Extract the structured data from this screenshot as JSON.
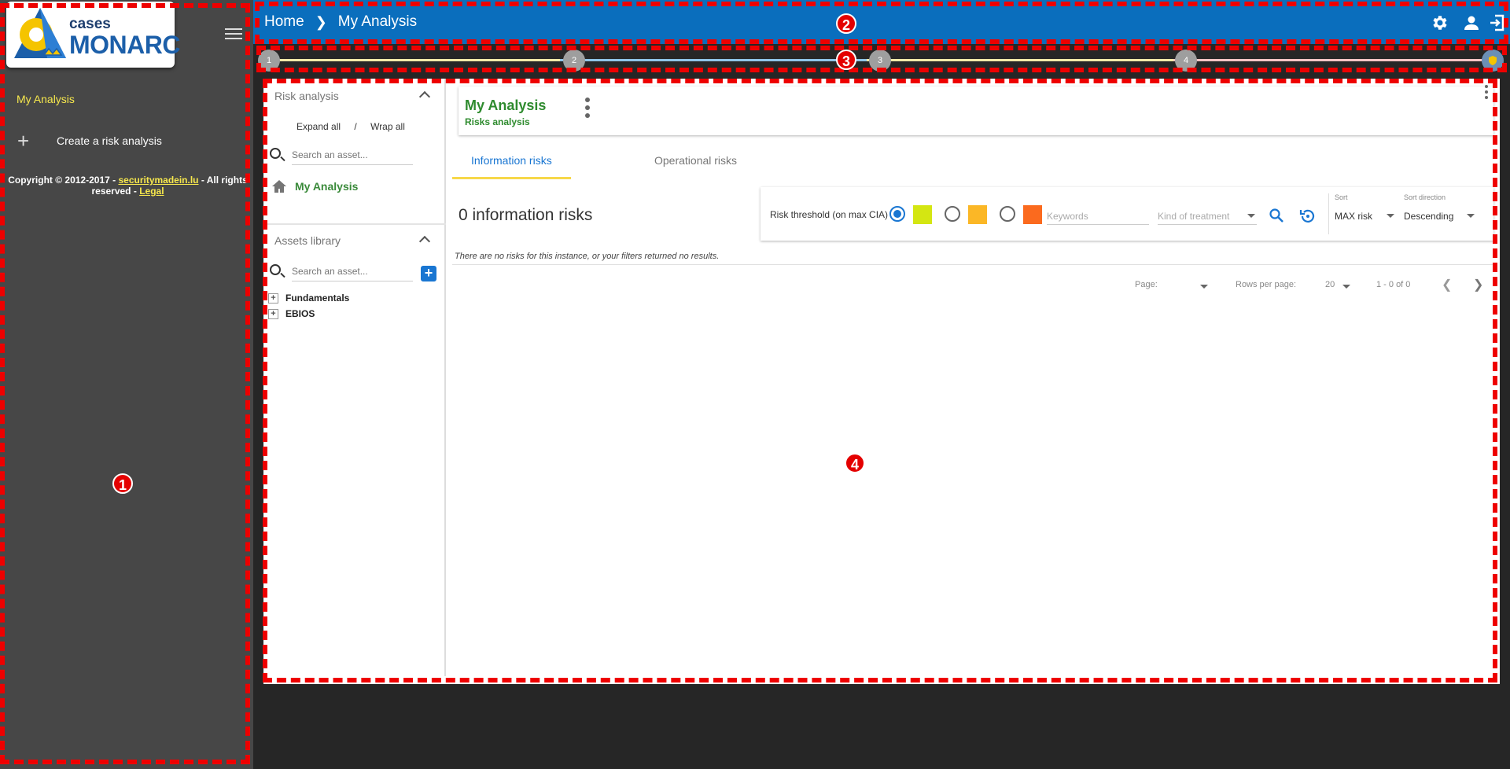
{
  "sidebar": {
    "logo_top": "cases",
    "logo_bottom": "MONARC",
    "current_analysis": "My Analysis",
    "create_label": "Create a risk analysis",
    "copyright_prefix": "Copyright © 2012-2017 -",
    "copyright_link": "securitymadein.lu",
    "copyright_mid": "- All rights reserved -",
    "legal_link": "Legal"
  },
  "header": {
    "home": "Home",
    "current": "My Analysis",
    "bg_color": "#0a6ebd"
  },
  "stepper": {
    "steps": [
      "1",
      "2",
      "3",
      "4"
    ]
  },
  "risk_tree": {
    "title": "Risk analysis",
    "expand_all": "Expand all",
    "separator": "/",
    "wrap_all": "Wrap all",
    "search_placeholder": "Search an asset...",
    "root": "My Analysis"
  },
  "assets_library": {
    "title": "Assets library",
    "search_placeholder": "Search an asset...",
    "items": [
      "Fundamentals",
      "EBIOS"
    ]
  },
  "analysis": {
    "title": "My Analysis",
    "subtitle": "Risks analysis",
    "tabs": [
      "Information risks",
      "Operational risks"
    ],
    "count_label": "0 information risks",
    "empty_message": "There are no risks for this instance, or your filters returned no results."
  },
  "filters": {
    "threshold_label": "Risk threshold (on max CIA)",
    "threshold_colors": [
      "#d4e612",
      "#fbb726",
      "#fb6a1e"
    ],
    "keywords_placeholder": "Keywords",
    "treatment_placeholder": "Kind of treatment",
    "sort_label": "Sort",
    "sort_value": "MAX risk",
    "direction_label": "Sort direction",
    "direction_value": "Descending"
  },
  "pagination": {
    "page_label": "Page:",
    "rows_label": "Rows per page:",
    "rows_value": "20",
    "range": "1 - 0 of 0"
  },
  "annotations": [
    "1",
    "2",
    "3",
    "4"
  ]
}
